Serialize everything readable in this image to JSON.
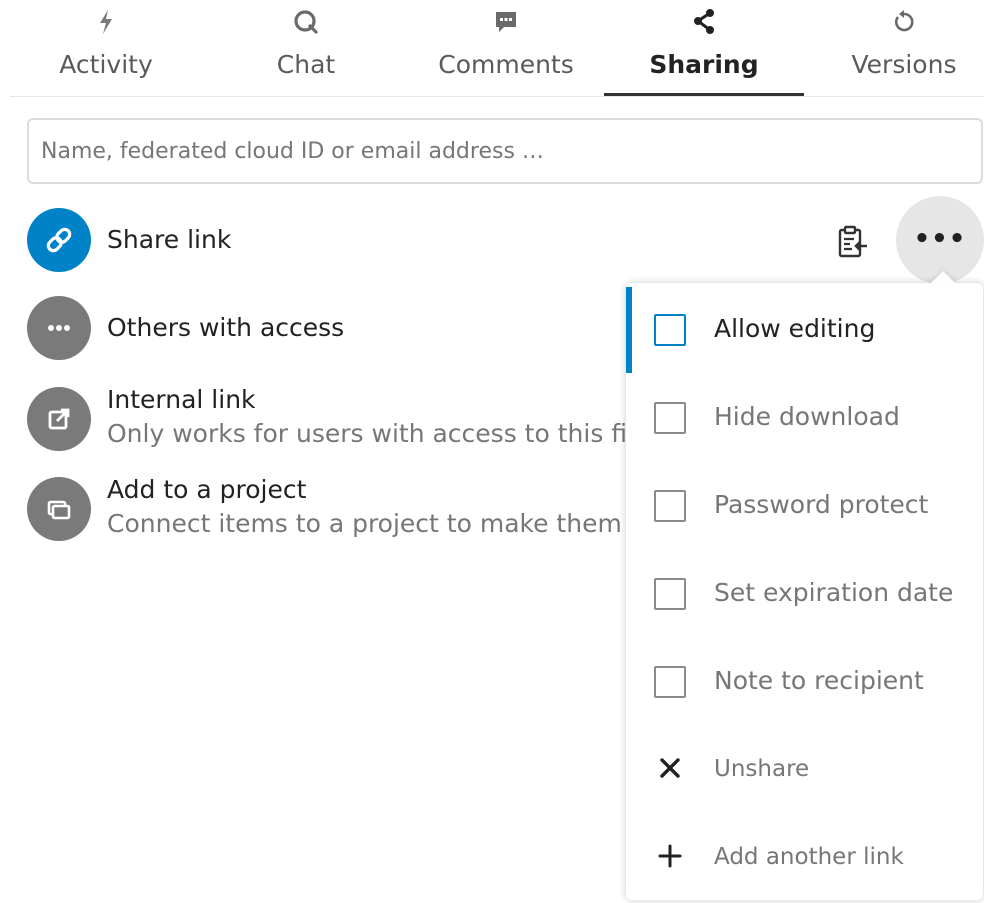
{
  "tabs": [
    {
      "label": "Activity",
      "icon": "lightning-icon"
    },
    {
      "label": "Chat",
      "icon": "chat-icon"
    },
    {
      "label": "Comments",
      "icon": "comment-icon"
    },
    {
      "label": "Sharing",
      "icon": "share-icon",
      "active": true
    },
    {
      "label": "Versions",
      "icon": "history-icon"
    }
  ],
  "search": {
    "placeholder": "Name, federated cloud ID or email address …",
    "value": ""
  },
  "share_link": {
    "title": "Share link",
    "icon": "link-icon",
    "copy_icon": "clipboard-icon",
    "more_label": "•••"
  },
  "others_with_access": {
    "title": "Others with access",
    "icon": "more-icon"
  },
  "internal_link": {
    "title": "Internal link",
    "subtitle": "Only works for users with access to this fi",
    "icon": "external-link-icon"
  },
  "add_to_project": {
    "title": "Add to a project",
    "subtitle": "Connect items to a project to make them",
    "icon": "project-icon"
  },
  "menu": {
    "items": [
      {
        "label": "Allow editing",
        "type": "checkbox",
        "checked": false,
        "focused": true
      },
      {
        "label": "Hide download",
        "type": "checkbox",
        "checked": false
      },
      {
        "label": "Password protect",
        "type": "checkbox",
        "checked": false
      },
      {
        "label": "Set expiration date",
        "type": "checkbox",
        "checked": false
      },
      {
        "label": "Note to recipient",
        "type": "checkbox",
        "checked": false
      },
      {
        "label": "Unshare",
        "type": "action",
        "icon": "close-icon"
      },
      {
        "label": "Add another link",
        "type": "action",
        "icon": "plus-icon"
      }
    ]
  },
  "colors": {
    "accent": "#0082c9",
    "avatar_gray": "#7a7a7a",
    "text_primary": "#222222",
    "text_muted": "#767676"
  }
}
